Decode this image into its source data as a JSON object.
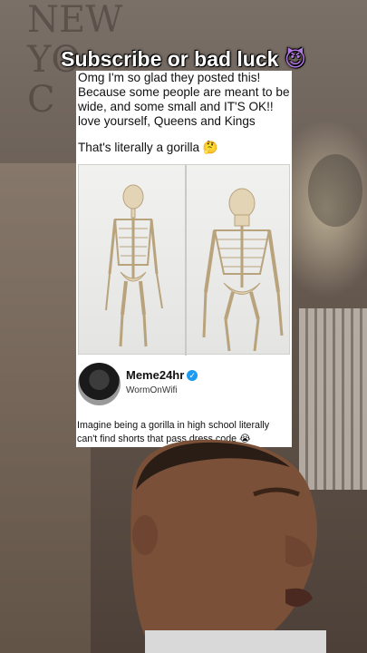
{
  "overlay": {
    "caption": "Subscribe or bad luck",
    "caption_emoji": "😈",
    "wall_sign": "NEW YO C"
  },
  "post": {
    "text": "Omg I'm so glad they posted this! Because some people are meant to be wide, and some small and IT'S OK!! love yourself, Queens and Kings",
    "text2": "That's literally a gorilla",
    "text2_emoji": "🤔",
    "image_subject": "skeleton-comparison"
  },
  "account": {
    "name": "Meme24hr",
    "verified_icon": "verified-badge-icon",
    "handle": "WormOnWifi",
    "caption": "Imagine being a gorilla in high school literally can't find shorts that pass dress code",
    "caption_emoji": "😭"
  },
  "colors": {
    "verified": "#1d9bf0",
    "caption_text": "#ffffff"
  }
}
